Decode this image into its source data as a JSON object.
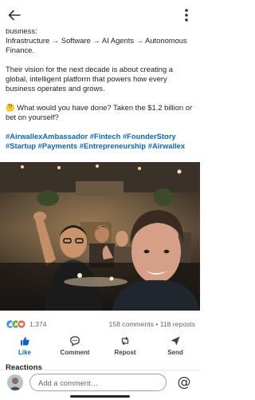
{
  "header": {
    "back_icon": "arrow-left-icon",
    "more_icon": "more-vertical-icon"
  },
  "post": {
    "partial_line": "business:",
    "pipeline": "Infrastructure → Software → AI Agents → Autonomous Finance.",
    "vision": "Their vision for the next decade is about creating a global, intelligent platform that powers how every business operates and grows.",
    "question_emoji": "🤔",
    "question": "What would you have done? Taken the $1.2 billion or bet on yourself?",
    "hashtags": [
      "#AirwallexAmbassador",
      "#Fintech",
      "#FounderStory",
      "#Startup",
      "#Payments",
      "#Entrepreneurship",
      "#Airwallex"
    ]
  },
  "engagement": {
    "reaction_count": "1,374",
    "comments": "158 comments",
    "separator": "•",
    "reposts": "118 reposts"
  },
  "actions": {
    "like": "Like",
    "comment": "Comment",
    "repost": "Repost",
    "send": "Send"
  },
  "reactions_heading": "Reactions",
  "comment_bar": {
    "placeholder": "Add a comment…",
    "mention_symbol": "@"
  },
  "colors": {
    "accent": "#0a66c2",
    "like_blue": "#378fe9",
    "love_red": "#df704d",
    "celebrate_green": "#6dae4f"
  }
}
